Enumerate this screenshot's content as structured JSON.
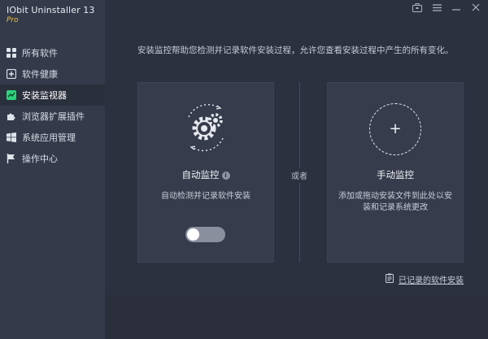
{
  "app": {
    "title": "IObit Uninstaller 13",
    "edition": "Pro"
  },
  "topbar": {
    "icons": [
      "toolbox-icon",
      "menu-icon",
      "minimize-icon",
      "close-icon"
    ]
  },
  "sidebar": {
    "items": [
      {
        "label": "所有软件",
        "icon": "grid-icon"
      },
      {
        "label": "软件健康",
        "icon": "health-plus-icon"
      },
      {
        "label": "安装监视器",
        "icon": "monitor-chart-icon",
        "active": true
      },
      {
        "label": "浏览器扩展插件",
        "icon": "puzzle-icon"
      },
      {
        "label": "系统应用管理",
        "icon": "windows-icon"
      },
      {
        "label": "操作中心",
        "icon": "flag-icon"
      }
    ]
  },
  "main": {
    "description": "安装监控帮助您检测并记录软件安装过程，允许您查看安装过程中产生的所有变化。",
    "or_text": "或者",
    "auto": {
      "title": "自动监控",
      "subtitle": "自动检测并记录软件安装",
      "toggle_on": false
    },
    "manual": {
      "title": "手动监控",
      "subtitle": "添加或拖动安装文件到此处以安装和记录系统更改"
    },
    "history_link": "已记录的软件安装"
  },
  "colors": {
    "active_accent": "#2bd37a",
    "edition": "#f0c233",
    "background": "#2c3140",
    "sidebar": "#343a4a"
  }
}
